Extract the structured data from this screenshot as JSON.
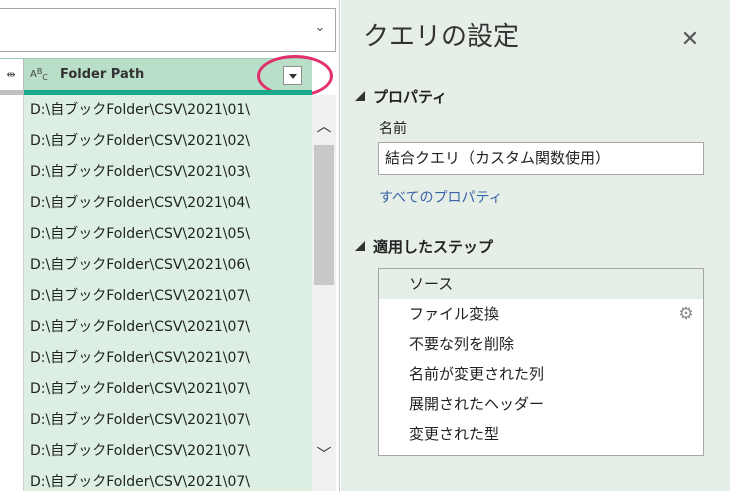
{
  "grid": {
    "column_header": {
      "type_icon": {
        "a": "A",
        "b": "B",
        "c": "C"
      },
      "title": "Folder Path"
    },
    "rows": [
      "D:\\自ブックFolder\\CSV\\2021\\01\\",
      "D:\\自ブックFolder\\CSV\\2021\\02\\",
      "D:\\自ブックFolder\\CSV\\2021\\03\\",
      "D:\\自ブックFolder\\CSV\\2021\\04\\",
      "D:\\自ブックFolder\\CSV\\2021\\05\\",
      "D:\\自ブックFolder\\CSV\\2021\\06\\",
      "D:\\自ブックFolder\\CSV\\2021\\07\\",
      "D:\\自ブックFolder\\CSV\\2021\\07\\",
      "D:\\自ブックFolder\\CSV\\2021\\07\\",
      "D:\\自ブックFolder\\CSV\\2021\\07\\",
      "D:\\自ブックFolder\\CSV\\2021\\07\\",
      "D:\\自ブックFolder\\CSV\\2021\\07\\",
      "D:\\自ブックFolder\\CSV\\2021\\07\\"
    ]
  },
  "settings": {
    "title": "クエリの設定",
    "close_glyph": "✕",
    "properties": {
      "heading": "プロパティ",
      "name_label": "名前",
      "name_value": "結合クエリ（カスタム関数使用）",
      "all_properties_link": "すべてのプロパティ"
    },
    "steps": {
      "heading": "適用したステップ",
      "items": [
        "ソース",
        "ファイル変換",
        "不要な列を削除",
        "名前が変更された列",
        "展開されたヘッダー",
        "変更された型"
      ]
    }
  },
  "colors": {
    "accent": "#19a98a",
    "highlight_ring": "#e1306c",
    "link": "#3a64a8",
    "pane_bg": "#e6efe7"
  },
  "icons": [
    "chevron-down-icon",
    "move-column-icon",
    "abc-type-icon",
    "filter-dropdown-icon",
    "close-icon",
    "gear-icon",
    "scroll-up-icon",
    "scroll-down-icon"
  ]
}
